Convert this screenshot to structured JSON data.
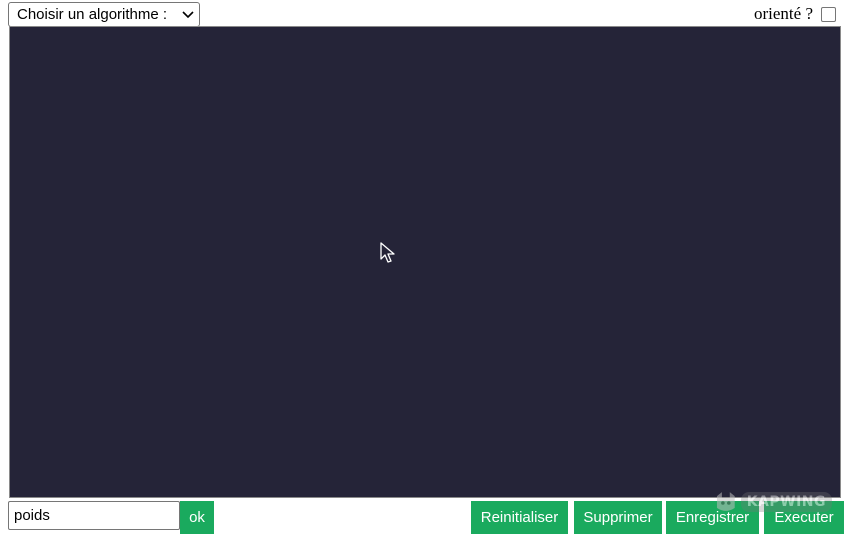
{
  "toolbar": {
    "algorithm_select": {
      "selected": "Choisir un algorithme :"
    },
    "oriented_label": "orienté ?",
    "oriented_checked": false
  },
  "canvas": {
    "background_color": "#252438"
  },
  "bottom_bar": {
    "weight_input": {
      "value": "poids"
    },
    "ok_label": "ok",
    "reset_label": "Reinitialiser",
    "delete_label": "Supprimer",
    "save_label": "Enregistrer",
    "run_label": "Executer"
  },
  "watermark": {
    "text": "KAPWING"
  },
  "colors": {
    "button": "#1aaa5e",
    "canvas": "#252438"
  }
}
